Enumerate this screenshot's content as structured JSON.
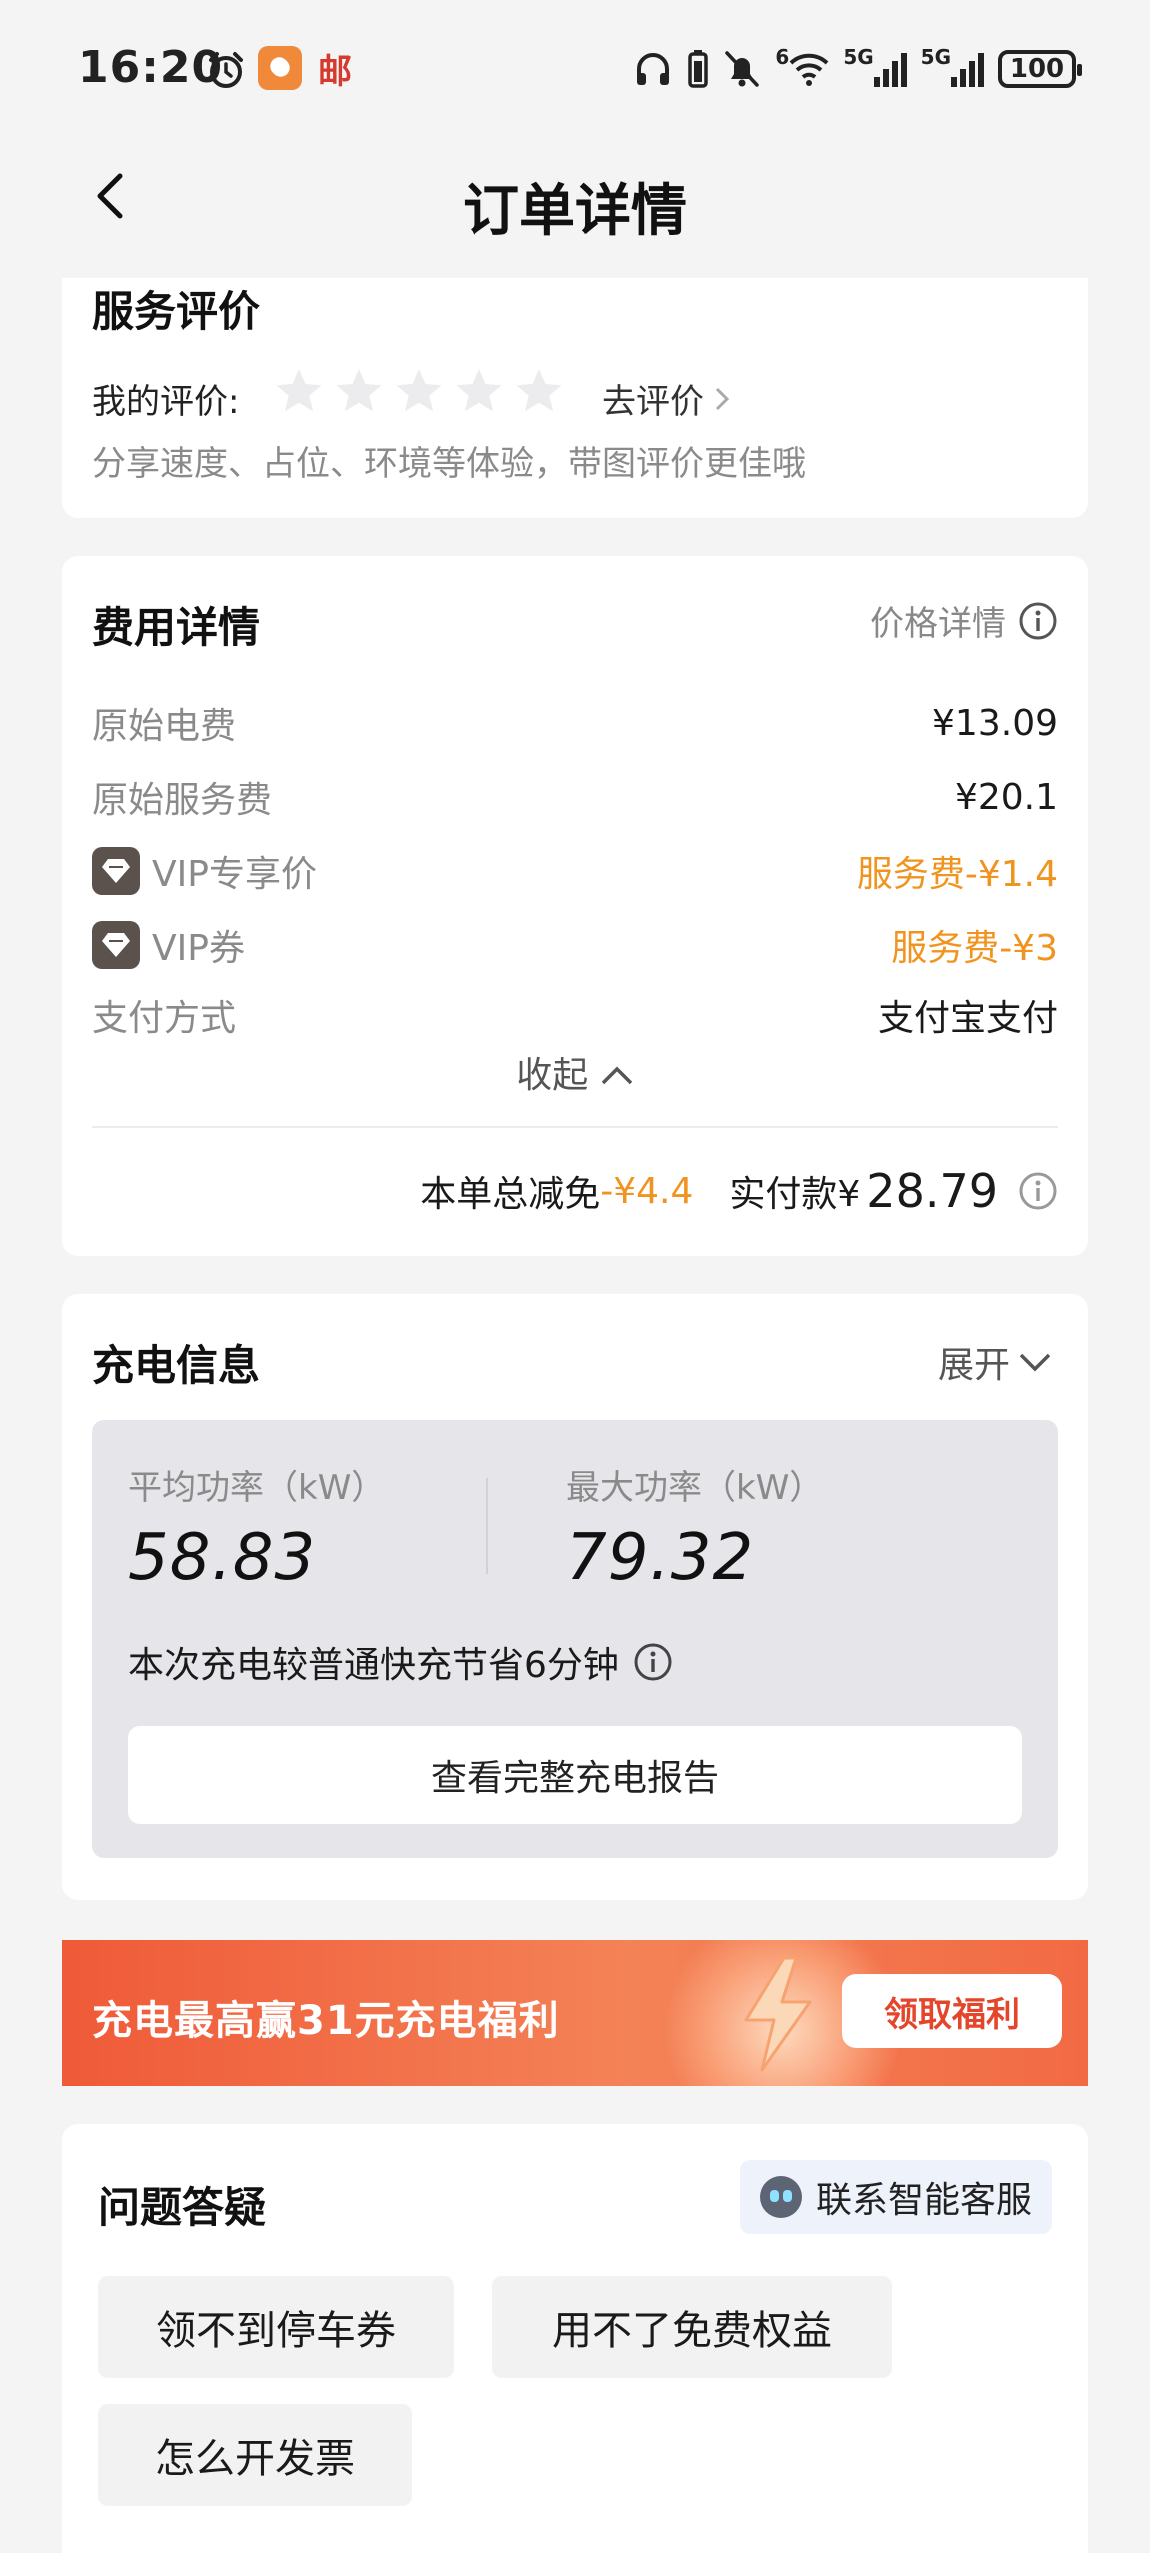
{
  "status_bar": {
    "time": "16:20",
    "app_badge": "邮",
    "network_1": "6",
    "network_2": "5G",
    "network_3": "5G",
    "battery": "100"
  },
  "nav": {
    "title": "订单详情"
  },
  "review": {
    "title": "服务评价",
    "my_rating_label": "我的评价:",
    "star_count": 5,
    "rating": 0,
    "go_review": "去评价",
    "hint": "分享速度、占位、环境等体验，带图评价更佳哦"
  },
  "fee": {
    "title": "费用详情",
    "price_detail": "价格详情",
    "rows": [
      {
        "label": "原始电费",
        "value": "¥13.09"
      },
      {
        "label": "原始服务费",
        "value": "¥20.1"
      },
      {
        "label": "VIP专享价",
        "value": "服务费-¥1.4"
      },
      {
        "label": "VIP券",
        "value": "服务费-¥3"
      },
      {
        "label": "支付方式",
        "value": "支付宝支付"
      }
    ],
    "collapse": "收起",
    "total_discount_label": "本单总减免",
    "total_discount_value": "-¥4.4",
    "paid_label": "实付款¥",
    "paid_amount": "28.79"
  },
  "charge": {
    "title": "充电信息",
    "expand": "展开",
    "avg_power_label": "平均功率（kW）",
    "avg_power": "58.83",
    "max_power_label": "最大功率（kW）",
    "max_power": "79.32",
    "saving_text": "本次充电较普通快充节省6分钟",
    "report_button": "查看完整充电报告"
  },
  "banner": {
    "text": "充电最高赢31元充电福利",
    "button": "领取福利"
  },
  "faq": {
    "title": "问题答疑",
    "contact": "联系智能客服",
    "questions": [
      "领不到停车券",
      "用不了免费权益",
      "怎么开发票"
    ]
  },
  "colors": {
    "accent_orange": "#f0941f",
    "banner_red": "#ef5a38",
    "page_bg": "#f4f4f5"
  }
}
